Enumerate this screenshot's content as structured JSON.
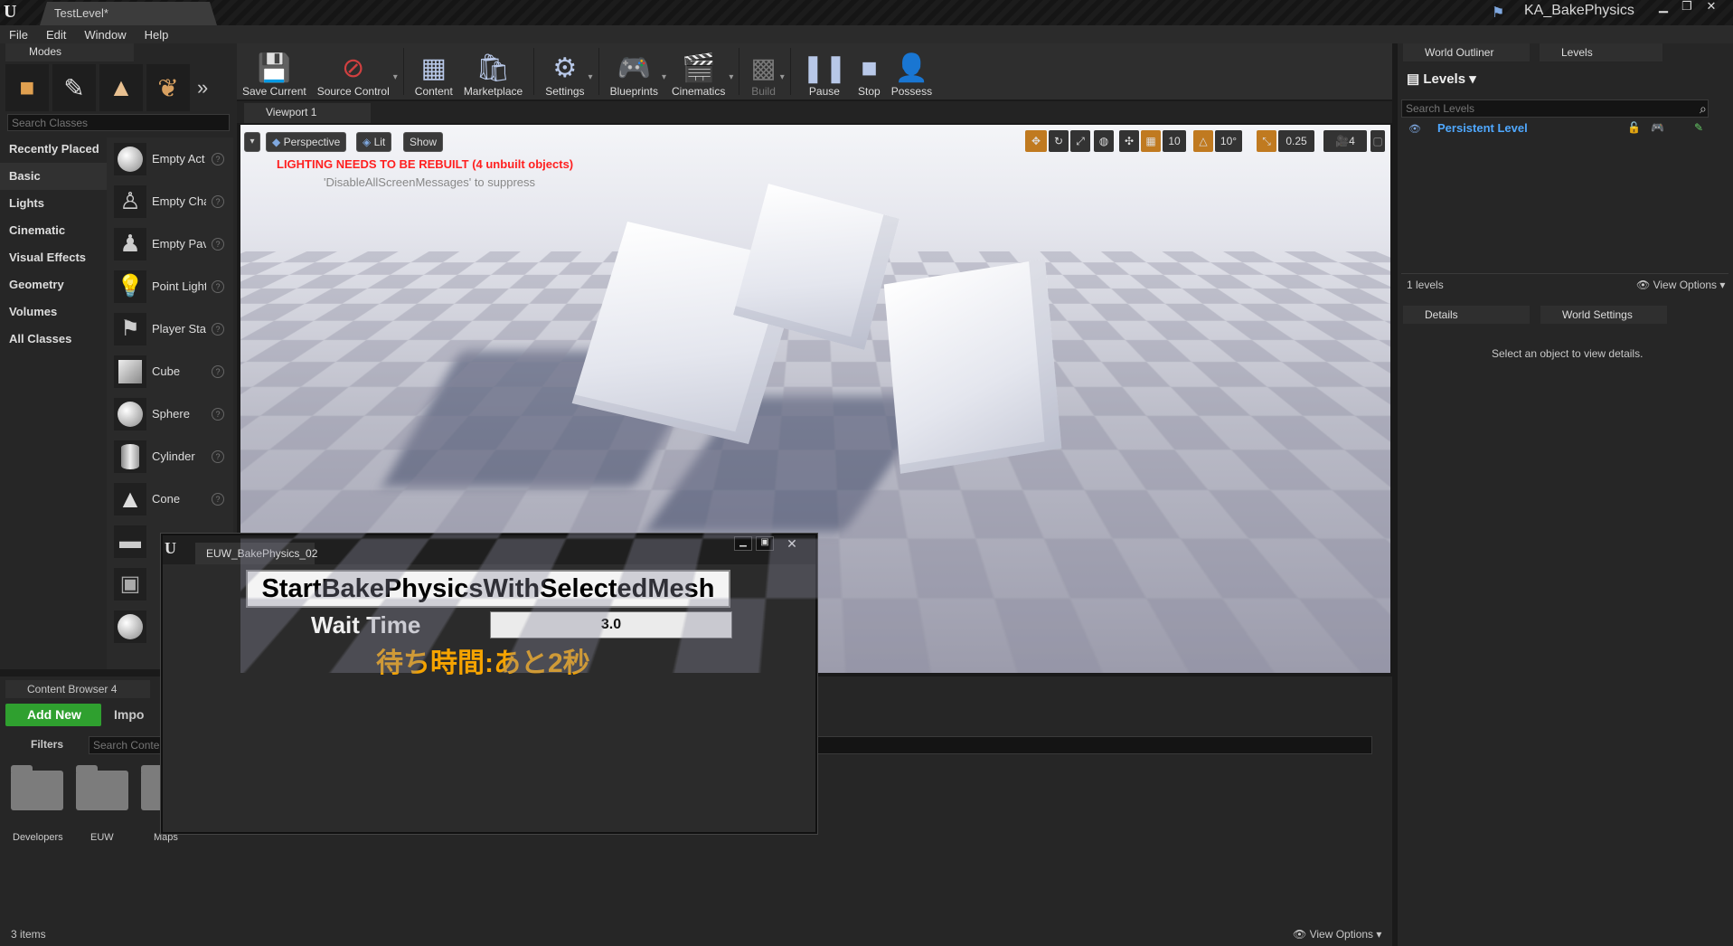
{
  "titlebar": {
    "doc_tab": "TestLevel*",
    "project": "KA_BakePhysics"
  },
  "menu": [
    "File",
    "Edit",
    "Window",
    "Help"
  ],
  "modes": {
    "tab": "Modes",
    "search_placeholder": "Search Classes",
    "categories": [
      "Recently Placed",
      "Basic",
      "Lights",
      "Cinematic",
      "Visual Effects",
      "Geometry",
      "Volumes",
      "All Classes"
    ],
    "items": [
      "Empty Act",
      "Empty Cha",
      "Empty Pav",
      "Point Light",
      "Player Sta",
      "Cube",
      "Sphere",
      "Cylinder",
      "Cone"
    ]
  },
  "toolbar": {
    "save": "Save Current",
    "source": "Source Control",
    "content": "Content",
    "marketplace": "Marketplace",
    "settings": "Settings",
    "blueprints": "Blueprints",
    "cinematics": "Cinematics",
    "build": "Build",
    "pause": "Pause",
    "stop": "Stop",
    "possess": "Possess"
  },
  "viewport": {
    "tab": "Viewport 1",
    "perspective": "Perspective",
    "lit": "Lit",
    "show": "Show",
    "warning": "LIGHTING NEEDS TO BE REBUILT (4 unbuilt objects)",
    "suppress": "'DisableAllScreenMessages' to suppress",
    "grid": "10",
    "rotation": "10°",
    "scale": "0.25",
    "camera_speed": "4"
  },
  "outliner": {
    "tab1": "World Outliner",
    "tab2": "Levels",
    "levels_label": "Levels",
    "search_placeholder": "Search Levels",
    "persistent": "Persistent Level",
    "count": "1 levels",
    "view_options": "View Options"
  },
  "details": {
    "tab1": "Details",
    "tab2": "World Settings",
    "empty": "Select an object to view details."
  },
  "content_browser": {
    "tab": "Content Browser 4",
    "add_new": "Add New",
    "import": "Impo",
    "filters": "Filters",
    "search_placeholder": "Search Conte",
    "folders": [
      "Developers",
      "EUW",
      "Maps"
    ],
    "count": "3 items",
    "view_options": "View Options"
  },
  "euw": {
    "tab": "EUW_BakePhysics_02",
    "button": "StartBakePhysicsWithSelectedMesh",
    "wait_label": "Wait Time",
    "wait_value": "3.0",
    "remaining": "待ち時間:あと2秒"
  },
  "colors": {
    "accent_green": "#2fa02f",
    "warning_red": "#ff2020",
    "orange": "#f5a300",
    "link_blue": "#4fa8ff"
  }
}
